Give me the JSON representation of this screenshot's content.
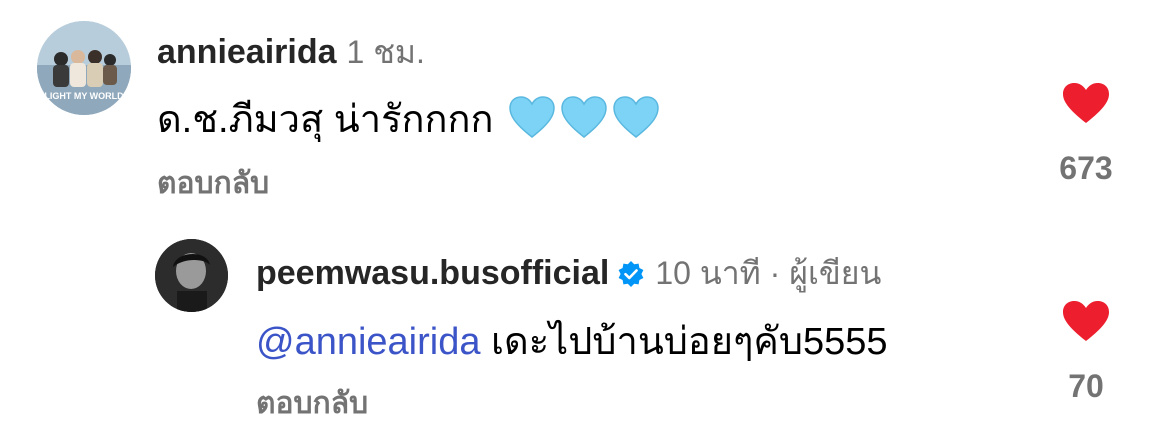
{
  "comments": [
    {
      "username": "annieairida",
      "time": "1 ชม.",
      "text": "ด.ช.ภีมวสุ น่ารักกกก",
      "emoji": [
        "light-blue-heart",
        "light-blue-heart",
        "light-blue-heart"
      ],
      "reply_label": "ตอบกลับ",
      "likes": "673",
      "avatar": {
        "caption": "LIGHT MY WORLD"
      }
    },
    {
      "username": "peemwasu.busofficial",
      "verified": true,
      "time": "10 นาที · ผู้เขียน",
      "mention": "@annieairida",
      "text": " เดะไปบ้านบ่อยๆคับ5555",
      "reply_label": "ตอบกลับ",
      "likes": "70"
    }
  ],
  "colors": {
    "like": "#ed1f2f",
    "mention": "#3b54c7",
    "emoji_heart": "#7dd3f5",
    "verified": "#0095f6"
  }
}
